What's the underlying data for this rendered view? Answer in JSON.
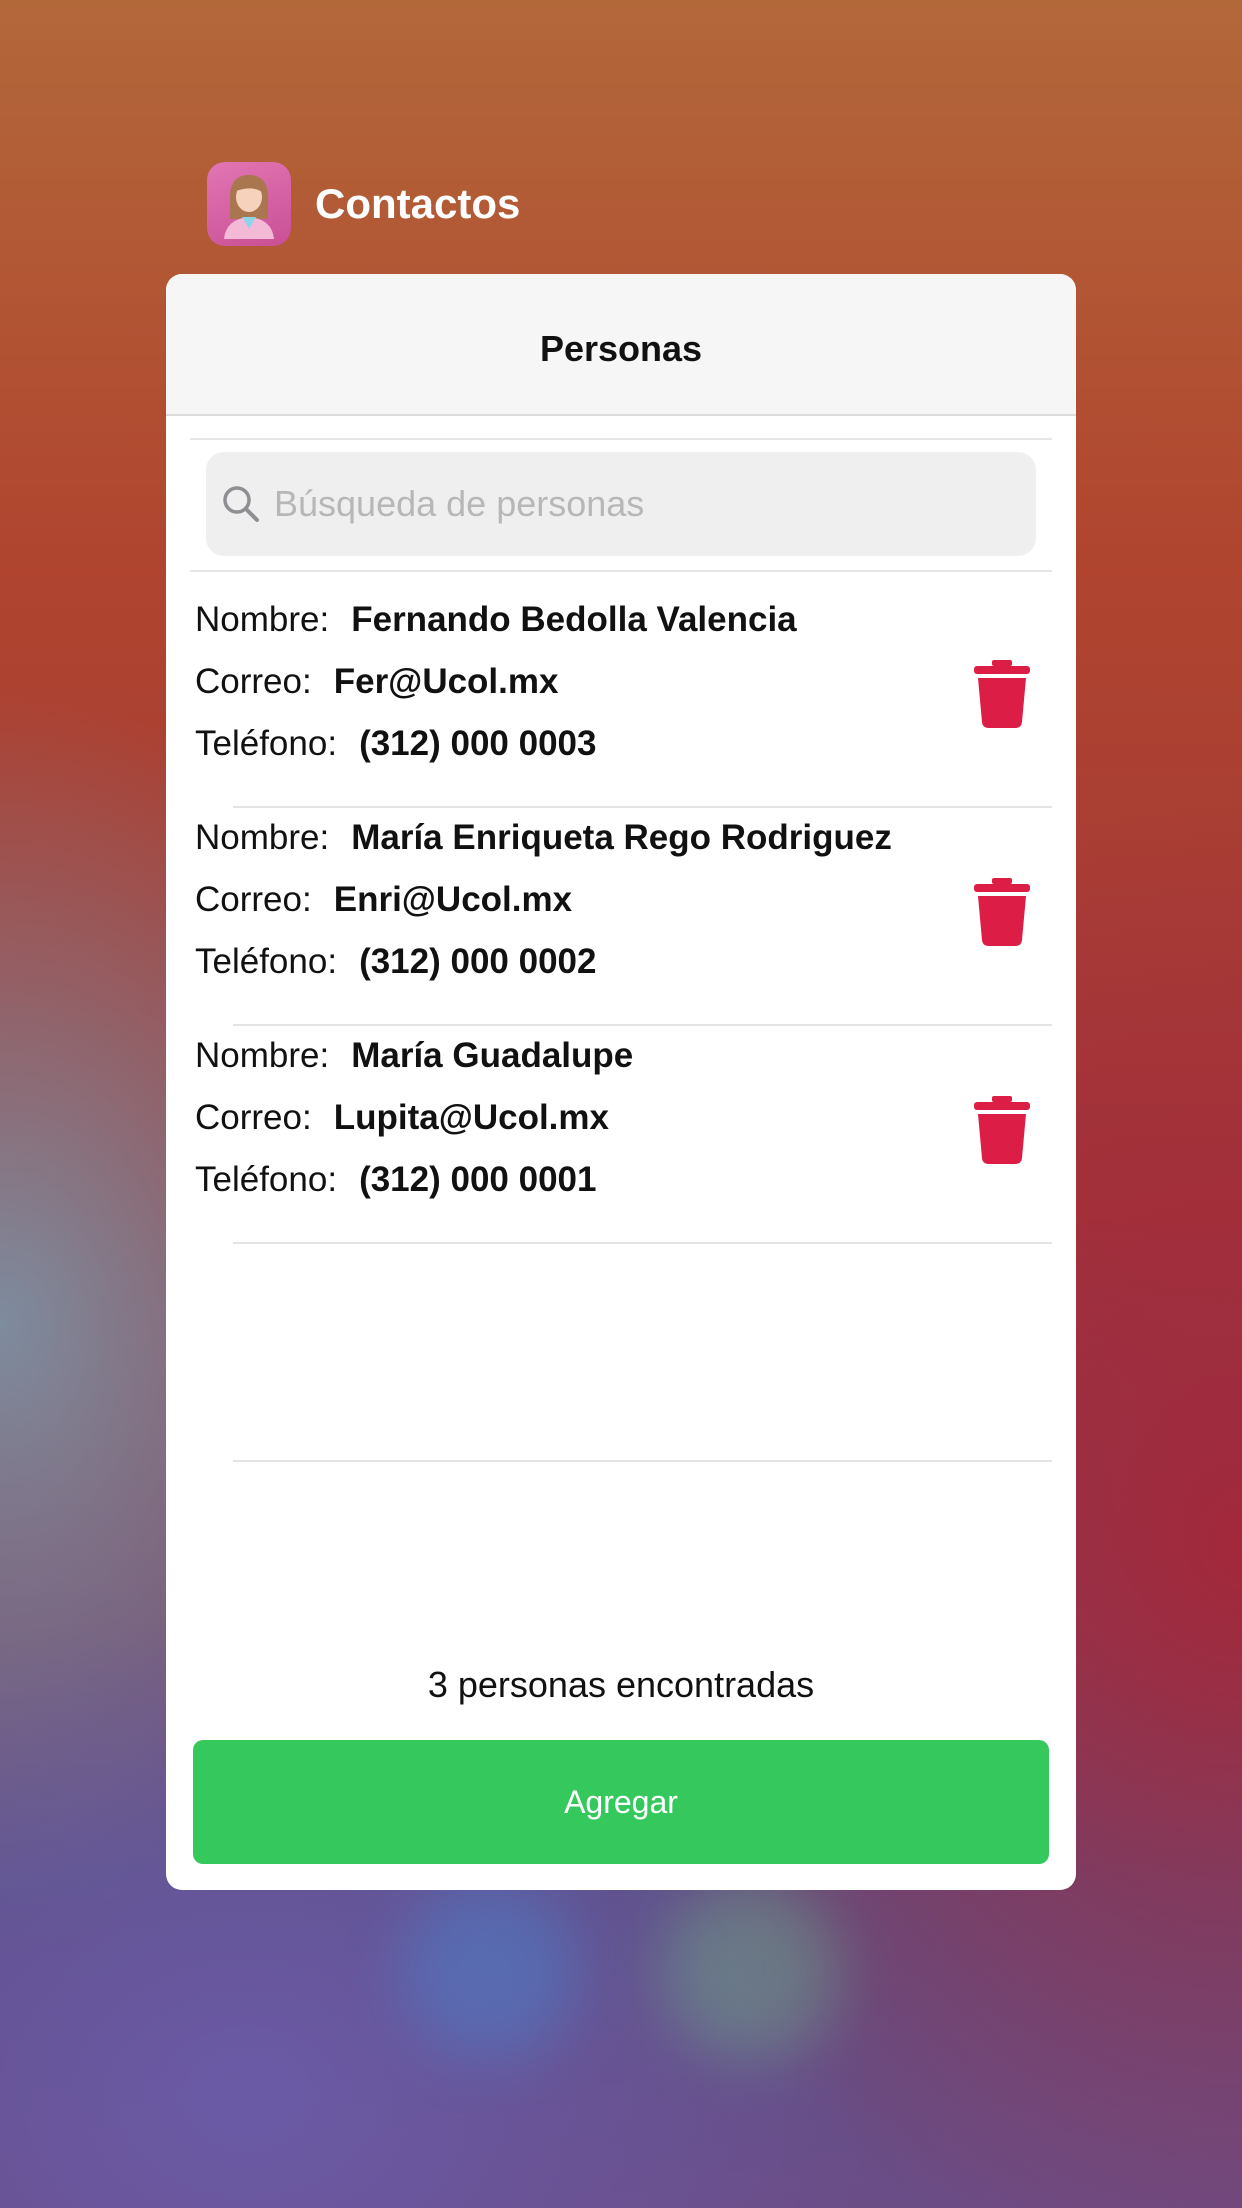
{
  "app": {
    "name": "Contactos"
  },
  "nav": {
    "title": "Personas"
  },
  "search": {
    "placeholder": "Búsqueda de personas"
  },
  "labels": {
    "name": "Nombre:",
    "email": "Correo:",
    "phone": "Teléfono:"
  },
  "people": [
    {
      "name": "Fernando Bedolla Valencia",
      "email": "Fer@Ucol.mx",
      "phone": "(312) 000 0003"
    },
    {
      "name": "María Enriqueta Rego Rodriguez",
      "email": "Enri@Ucol.mx",
      "phone": "(312) 000 0002"
    },
    {
      "name": "María Guadalupe",
      "email": "Lupita@Ucol.mx",
      "phone": "(312) 000 0001"
    }
  ],
  "footer": {
    "count_text": "3 personas encontradas",
    "add_label": "Agregar"
  },
  "colors": {
    "accent_green": "#35c95d",
    "delete_red": "#dc1d45",
    "app_icon": "#d15fa2"
  },
  "icons": {
    "search": "search-icon",
    "delete": "trash-icon",
    "app": "person-avatar-icon"
  }
}
